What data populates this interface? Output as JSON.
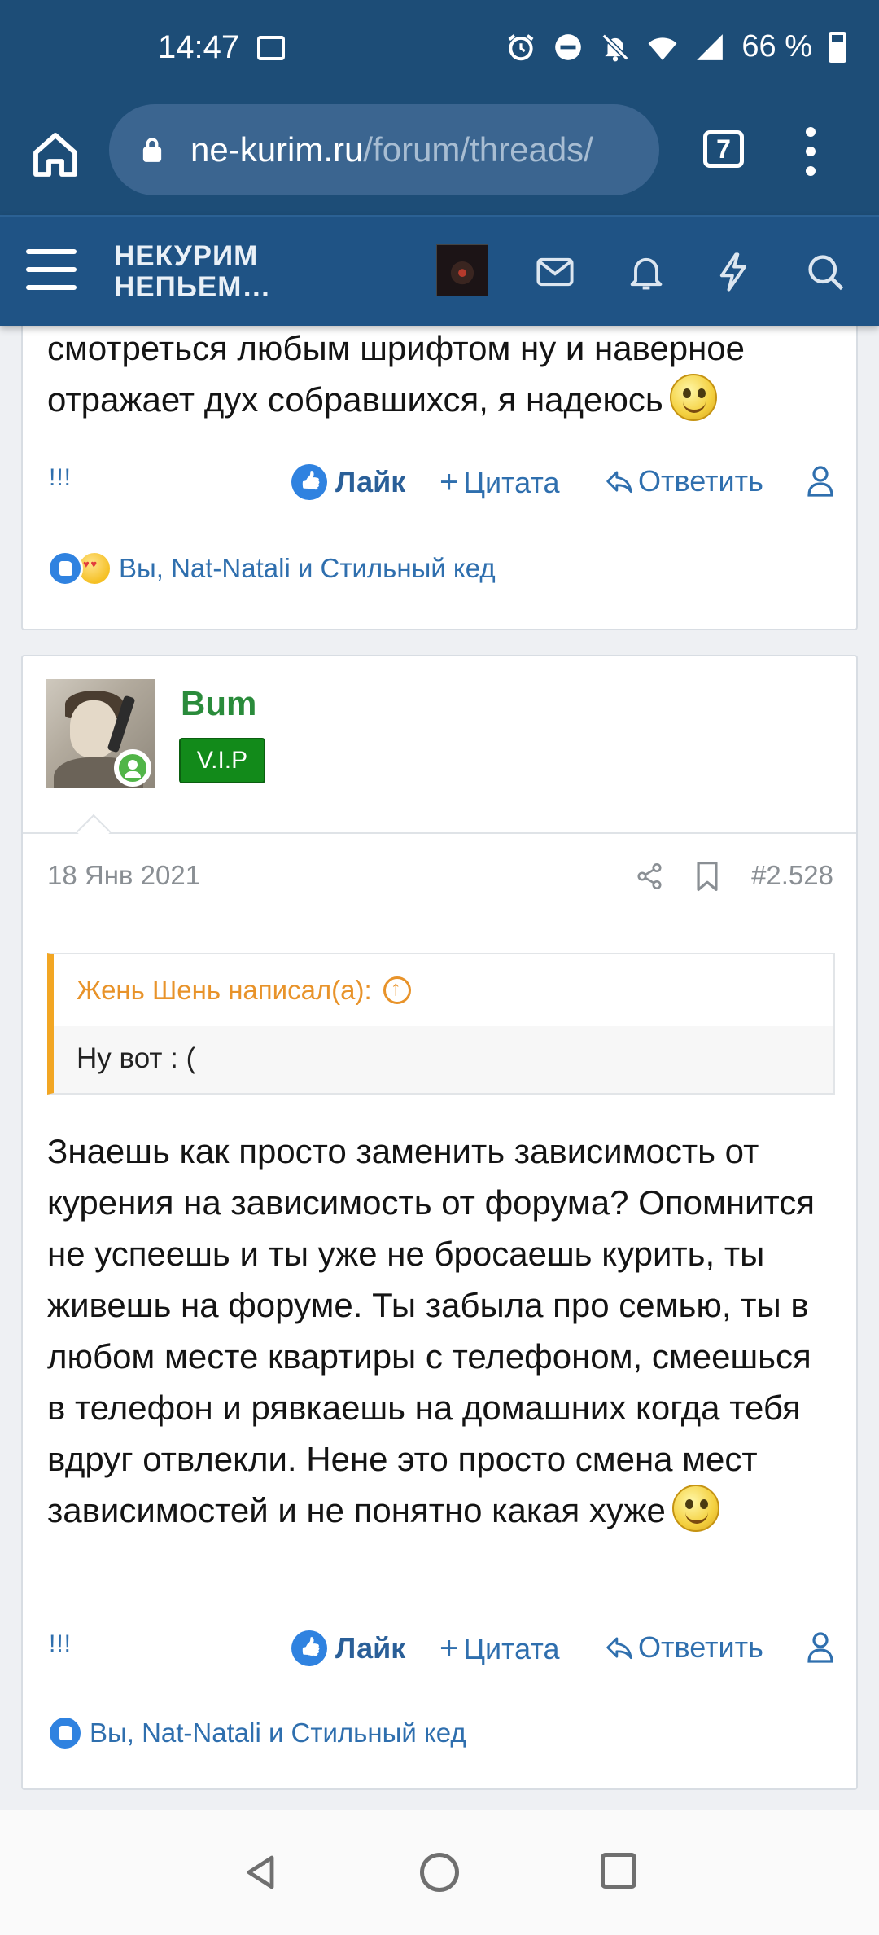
{
  "status_bar": {
    "time": "14:47",
    "battery": "66 %",
    "icons": [
      "image-icon",
      "alarm-icon",
      "dnd-icon",
      "bell-off-icon",
      "wifi-icon",
      "signal-icon",
      "battery-icon"
    ]
  },
  "browser": {
    "url_host": "ne-kurim.ru",
    "url_path": "/forum/threads/",
    "tab_count": "7"
  },
  "site_header": {
    "logo_line1": "НЕКУРИМ",
    "logo_line2": "НЕПЬЕМ…",
    "icons": [
      "menu-icon",
      "mail-icon",
      "bell-icon",
      "lightning-icon",
      "search-icon"
    ]
  },
  "post1": {
    "text": "смотреться любым шрифтом ну и наверное отражает дух собравшихся, я надеюсь",
    "actions": {
      "bang": "!!!",
      "like": "Лайк",
      "quote": "Цитата",
      "reply": "Ответить"
    },
    "reactions_text": "Вы, Nat-Natali и Стильный кед"
  },
  "post2": {
    "author": "Bum",
    "badge": "V.I.P",
    "date": "18 Янв 2021",
    "number": "#2.528",
    "quote_author": "Жень Шень написал(а):",
    "quote_text": "Ну вот : (",
    "text": "Знаешь как просто заменить зависимость от курения на зависимость от форума? Опомнится не успеешь и ты уже не бросаешь курить, ты живешь на форуме. Ты забыла про семью, ты в любом месте квартиры с телефоном, смеешься в телефон и рявкаешь на домашних когда тебя вдруг отвлекли. Нене это просто смена мест зависимостей и не понятно какая хуже",
    "actions": {
      "bang": "!!!",
      "like": "Лайк",
      "quote": "Цитата",
      "reply": "Ответить"
    },
    "reactions_text": "Вы, Nat-Natali и Стильный кед"
  },
  "colors": {
    "header_bg": "#1f5385",
    "status_bg": "#1d4d77",
    "link": "#2f6fae",
    "author_green": "#2a8b3b",
    "vip_green": "#128a1a",
    "quote_accent": "#f2a623"
  }
}
